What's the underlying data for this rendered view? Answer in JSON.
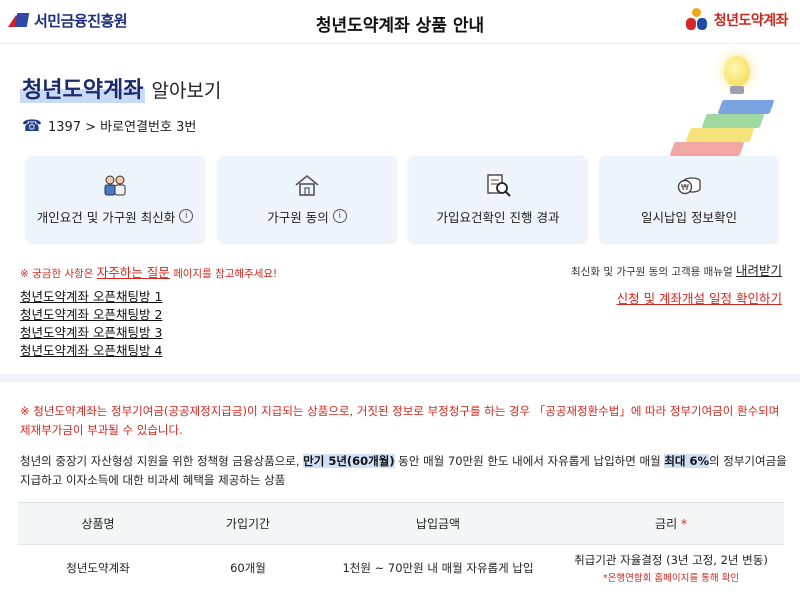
{
  "header": {
    "left_logo": "서민금융진흥원",
    "title": "청년도약계좌 상품 안내",
    "right_logo": "청년도약계좌"
  },
  "intro": {
    "title_highlight": "청년도약계좌",
    "title_rest": " 알아보기",
    "phone_icon": "phone-icon",
    "phone_text": "1397 > 바로연결번호 3번"
  },
  "cards": [
    {
      "label": "개인요건 및 가구원 최신화",
      "icon": "family-icon",
      "has_info": true
    },
    {
      "label": "가구원 동의",
      "icon": "house-icon",
      "has_info": true
    },
    {
      "label": "가입요건확인 진행 경과",
      "icon": "document-search-icon",
      "has_info": false
    },
    {
      "label": "일시납입 정보확인",
      "icon": "coins-icon",
      "has_info": false
    }
  ],
  "info_glyph": "i",
  "notice": {
    "prefix": "※ 궁금한 사항은 ",
    "link": "자주하는 질문",
    "suffix": " 페이지를 참고해주세요!",
    "manual_prefix": "최신화 및 가구원 동의 고객용 매뉴얼 ",
    "manual_link": "내려받기",
    "schedule_link": "신청 및 계좌개설 일정 확인하기"
  },
  "chat_rooms": [
    "청년도약계좌 오픈채팅방 1",
    "청년도약계좌 오픈채팅방 2",
    "청년도약계좌 오픈채팅방 3",
    "청년도약계좌 오픈채팅방 4"
  ],
  "warning": "※ 청년도약계좌는 정부기여금(공공재정지급금)이 지급되는 상품으로, 거짓된 정보로 부정청구를 하는 경우 「공공재정환수법」에 따라 정부기여금이 환수되며 제재부가금이 부과될 수 있습니다.",
  "description": {
    "part1": "청년의 중장기 자산형성 지원을 위한 정책형 금융상품으로, ",
    "hl1": "만기 5년(60개월)",
    "part2": " 동안 매월 70만원 한도 내에서 자유롭게 납입하면 매월 ",
    "hl2": "최대 6%",
    "part3": "의 정부기여금을 지급하고 이자소득에 대한 비과세 혜택을 제공하는 상품"
  },
  "table": {
    "headers": [
      "상품명",
      "가입기간",
      "납입금액",
      "금리"
    ],
    "rate_star": "*",
    "row": {
      "name": "청년도약계좌",
      "period": "60개월",
      "amount": "1천원 ~ 70만원 내 매월 자유롭게 납입",
      "rate": "취급기관 자율결정 (3년 고정, 2년 변동)",
      "rate_note": "*은행연합회 홈페이지를 통해 확인"
    }
  },
  "colors": {
    "accent_red": "#d1281f",
    "brand_navy": "#1b2a6b",
    "card_bg": "#eef4fc",
    "highlight": "#cfe0f6"
  }
}
